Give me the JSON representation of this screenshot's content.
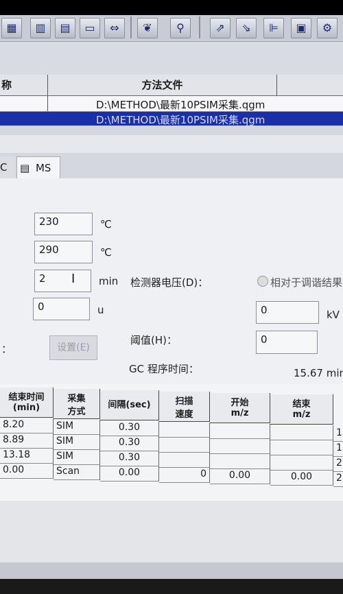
{
  "toolbar": {
    "icons": [
      "grid-icon",
      "panel-icon",
      "table-icon",
      "monitor-icon",
      "arrows-icon",
      "leaf-icon",
      "pin-icon",
      "flow-icon",
      "tool-icon",
      "chart-icon",
      "square-icon",
      "settings-icon"
    ]
  },
  "method_grid": {
    "col_name_partial": "称",
    "col_method_file": "方法文件",
    "row1_file": "D:\\METHOD\\最新10PSIM采集.qgm",
    "row2_file": "D:\\METHOD\\最新10PSIM采集.qgm"
  },
  "tabs": {
    "gc_partial": "C",
    "ms": "MS"
  },
  "form": {
    "field1_value": "230",
    "field1_unit": "℃",
    "field2_value": "290",
    "field2_unit": "℃",
    "field3_value": "2",
    "field3_unit": "min",
    "field4_value": "0",
    "field4_unit": "u",
    "detector_voltage_label": "检测器电压(D)：",
    "relative_tune_label": "相对于调谐结果",
    "voltage_value": "0",
    "voltage_unit": "kV",
    "threshold_label": "阈值(H)：",
    "threshold_value": "0",
    "settings_button": "设置(E)",
    "colon": "：",
    "gc_runtime_label": "GC 程序时间：",
    "gc_runtime_value": "15.67 min"
  },
  "table": {
    "headers": [
      "结束时间\n(min)",
      "采集\n方式",
      "间隔(sec)",
      "扫描\n速度",
      "开始\nm/z",
      "结束\nm/z"
    ],
    "rows": [
      {
        "end_time": "8.20",
        "mode": "SIM",
        "interval": "0.30",
        "speed": "",
        "start": "",
        "end": "",
        "extra": "1"
      },
      {
        "end_time": "8.89",
        "mode": "SIM",
        "interval": "0.30",
        "speed": "",
        "start": "",
        "end": "",
        "extra": "1"
      },
      {
        "end_time": "13.18",
        "mode": "SIM",
        "interval": "0.30",
        "speed": "",
        "start": "",
        "end": "",
        "extra": "2"
      },
      {
        "end_time": "0.00",
        "mode": "Scan",
        "interval": "0.00",
        "speed": "0",
        "start": "0.00",
        "end": "0.00",
        "extra": "2"
      }
    ]
  }
}
